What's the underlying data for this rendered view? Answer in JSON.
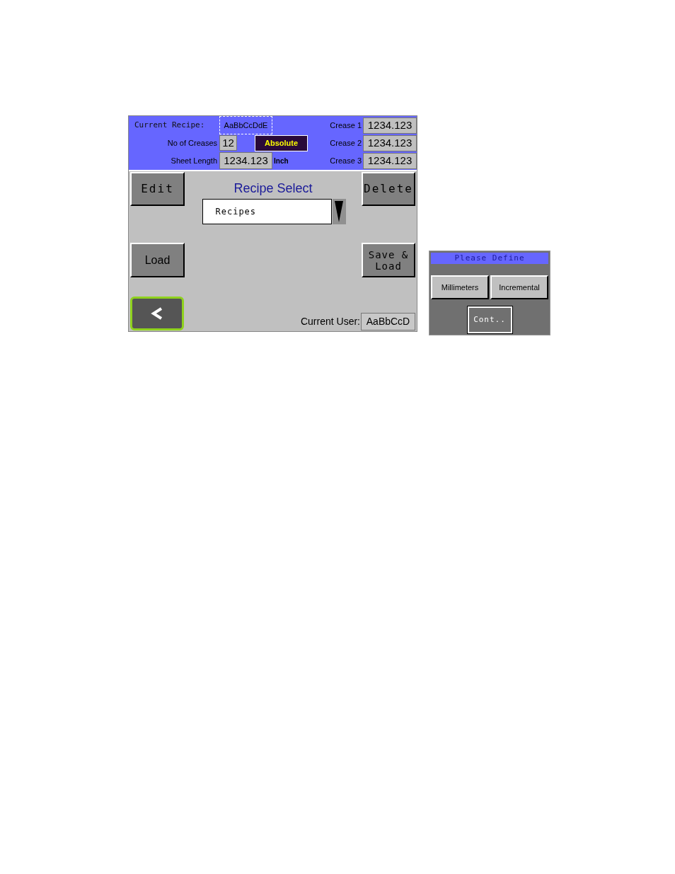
{
  "recipe_screen": {
    "current_recipe": {
      "label": "Current Recipe:",
      "value": "AaBbCcDdE"
    },
    "no_of_creases": {
      "label": "No of Creases",
      "value": "12"
    },
    "mode_button": "Absolute",
    "sheet_length": {
      "label": "Sheet Length",
      "value": "1234.123",
      "unit": "Inch"
    },
    "creases": [
      {
        "label": "Crease 1",
        "value": "1234.123"
      },
      {
        "label": "Crease 2",
        "value": "1234.123"
      },
      {
        "label": "Crease 3",
        "value": "1234.123"
      }
    ],
    "buttons": {
      "edit": "Edit",
      "delete": "Delete",
      "load": "Load",
      "save_load": "Save & Load"
    },
    "recipe_select": {
      "title": "Recipe Select",
      "dropdown_value": "Recipes"
    },
    "current_user": {
      "label": "Current User:",
      "value": "AaBbCcD"
    }
  },
  "dialog": {
    "title": "Please Define",
    "options": [
      "Millimeters",
      "Incremental"
    ],
    "button": "Cont.."
  }
}
